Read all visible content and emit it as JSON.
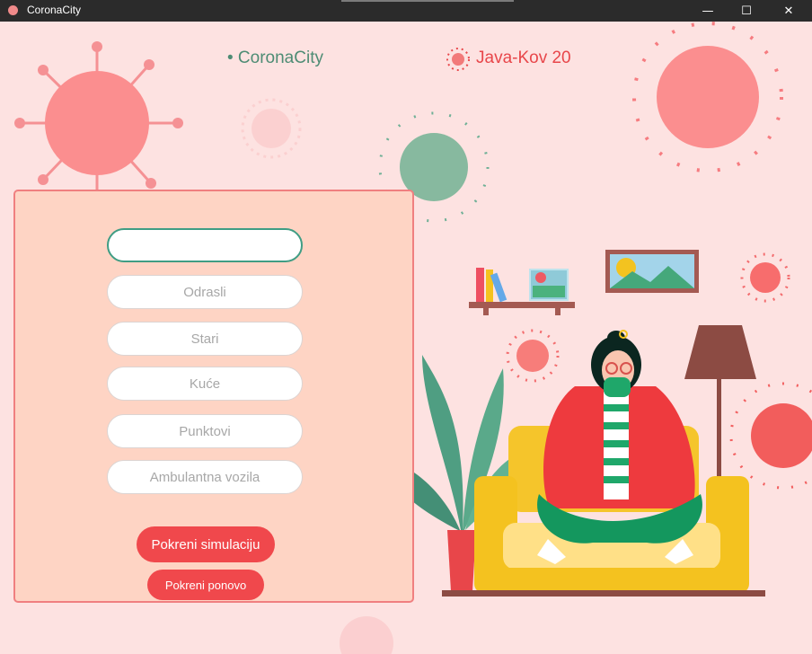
{
  "window": {
    "title": "CoronaCity",
    "minimize_glyph": "—",
    "maximize_glyph": "☐",
    "close_glyph": "✕"
  },
  "header": {
    "left_title": "• CoronaCity",
    "right_title": "Java-Kov 20"
  },
  "form": {
    "fields": [
      {
        "value": "",
        "placeholder": ""
      },
      {
        "value": "",
        "placeholder": "Odrasli"
      },
      {
        "value": "",
        "placeholder": "Stari"
      },
      {
        "value": "",
        "placeholder": "Kuće"
      },
      {
        "value": "",
        "placeholder": "Punktovi"
      },
      {
        "value": "",
        "placeholder": "Ambulantna vozila"
      }
    ],
    "start_button": "Pokreni simulaciju",
    "restart_button": "Pokreni ponovo"
  },
  "colors": {
    "background": "#fde2e1",
    "panel": "#fed4c4",
    "panel_border": "#f07f80",
    "accent_red": "#f0484c",
    "accent_green": "#4e8c74"
  },
  "icons": [
    "app-icon",
    "virus-icon",
    "minimize-icon",
    "maximize-icon",
    "close-icon"
  ]
}
